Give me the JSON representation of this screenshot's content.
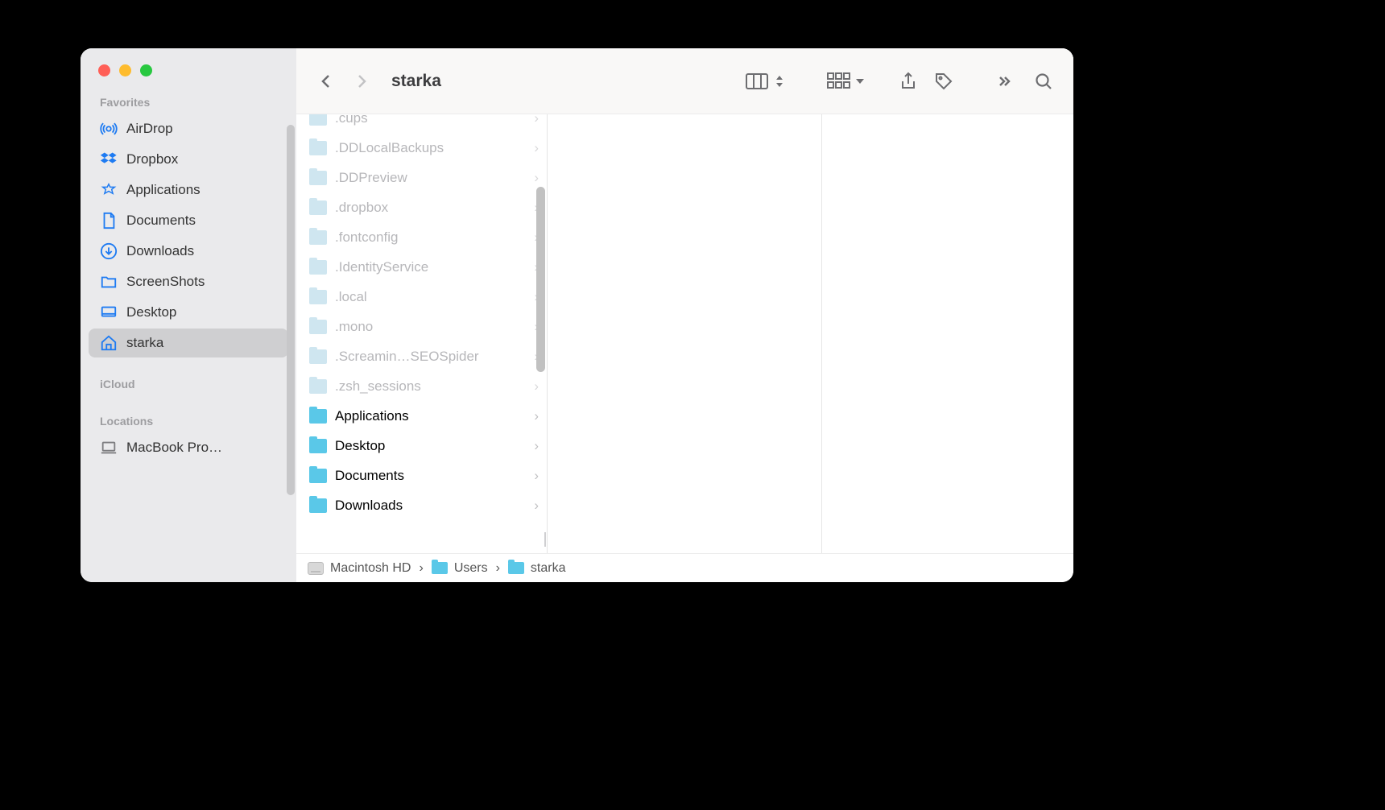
{
  "window_title": "starka",
  "sidebar": {
    "sections": {
      "favorites_label": "Favorites",
      "icloud_label": "iCloud",
      "locations_label": "Locations"
    },
    "favorites": [
      {
        "icon": "airdrop",
        "label": "AirDrop"
      },
      {
        "icon": "dropbox",
        "label": "Dropbox"
      },
      {
        "icon": "apps",
        "label": "Applications"
      },
      {
        "icon": "doc",
        "label": "Documents"
      },
      {
        "icon": "downloads",
        "label": "Downloads"
      },
      {
        "icon": "screenshots",
        "label": "ScreenShots"
      },
      {
        "icon": "desktop",
        "label": "Desktop"
      },
      {
        "icon": "home",
        "label": "starka",
        "selected": true
      }
    ],
    "locations": [
      {
        "icon": "laptop",
        "label": "MacBook Pro…"
      }
    ]
  },
  "column1": {
    "items": [
      {
        "name": ".cups",
        "hidden": true
      },
      {
        "name": ".DDLocalBackups",
        "hidden": true
      },
      {
        "name": ".DDPreview",
        "hidden": true
      },
      {
        "name": ".dropbox",
        "hidden": true
      },
      {
        "name": ".fontconfig",
        "hidden": true
      },
      {
        "name": ".IdentityService",
        "hidden": true
      },
      {
        "name": ".local",
        "hidden": true
      },
      {
        "name": ".mono",
        "hidden": true
      },
      {
        "name": ".Screamin…SEOSpider",
        "hidden": true
      },
      {
        "name": ".zsh_sessions",
        "hidden": true
      },
      {
        "name": "Applications",
        "hidden": false
      },
      {
        "name": "Desktop",
        "hidden": false
      },
      {
        "name": "Documents",
        "hidden": false
      },
      {
        "name": "Downloads",
        "hidden": false
      }
    ]
  },
  "pathbar": {
    "crumbs": [
      {
        "icon": "hd",
        "label": "Macintosh HD"
      },
      {
        "icon": "folder",
        "label": "Users"
      },
      {
        "icon": "folder",
        "label": "starka"
      }
    ]
  }
}
